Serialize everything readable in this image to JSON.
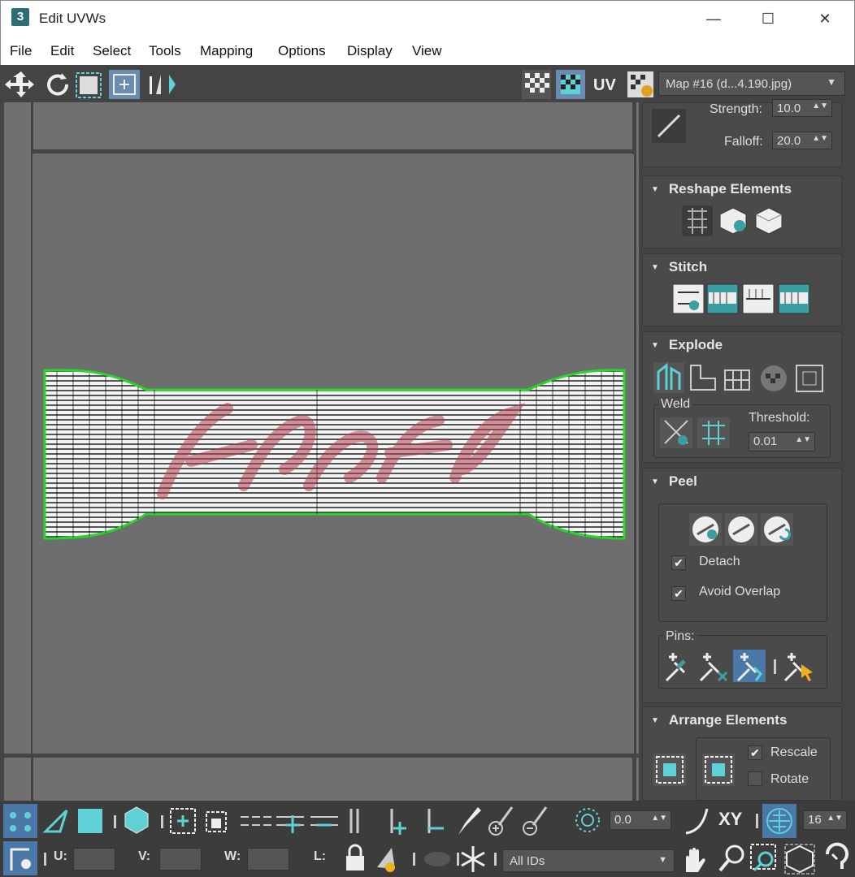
{
  "window": {
    "title": "Edit UVWs",
    "app_icon": "3",
    "minimize": "—",
    "maximize": "☐",
    "close": "✕"
  },
  "menu": [
    "File",
    "Edit",
    "Select",
    "Tools",
    "Mapping",
    "Options",
    "Display",
    "View"
  ],
  "toolbar": {
    "uv_label": "UV",
    "map_dropdown": "Map #16 (d...4.190.jpg)"
  },
  "soft": {
    "strength_label": "Strength:",
    "strength_value": "10.0",
    "falloff_label": "Falloff:",
    "falloff_value": "20.0"
  },
  "rollouts": {
    "reshape": "Reshape Elements",
    "stitch": "Stitch",
    "explode": "Explode",
    "peel": "Peel",
    "arrange": "Arrange Elements"
  },
  "weld": {
    "label": "Weld",
    "threshold_label": "Threshold:",
    "threshold_value": "0.01"
  },
  "peel": {
    "detach": "Detach",
    "avoid_overlap": "Avoid Overlap",
    "pins": "Pins:"
  },
  "arrange": {
    "rescale": "Rescale",
    "rotate": "Rotate"
  },
  "bottom": {
    "angle_value": "0.0",
    "xy": "XY",
    "grid_value": "16",
    "u": "U:",
    "v": "V:",
    "w": "W:",
    "l": "L:",
    "ids": "All IDs"
  },
  "colors": {
    "accent": "#3a9ea3",
    "uv_edge": "#27d627",
    "texture": "#b04050"
  }
}
